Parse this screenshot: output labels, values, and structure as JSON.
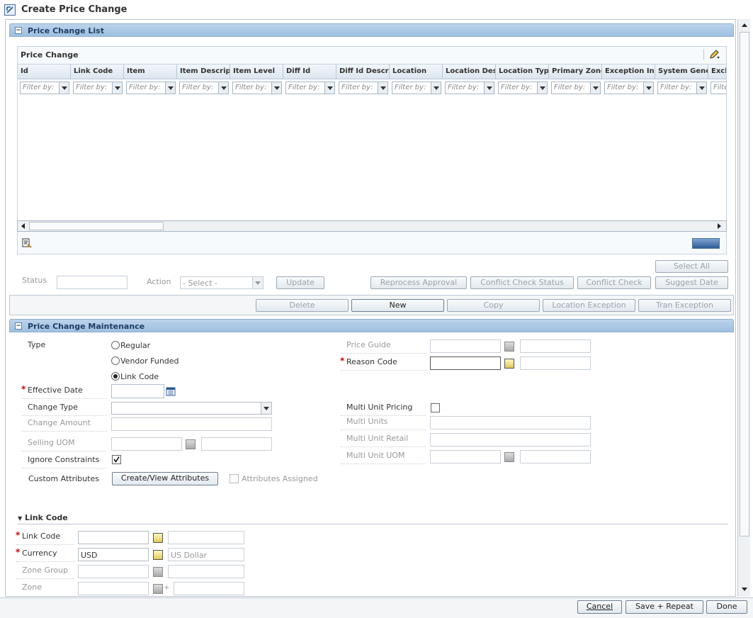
{
  "page": {
    "title": "Create Price Change"
  },
  "price_change_list": {
    "section_title": "Price Change List",
    "grid_title": "Price Change",
    "filter_placeholder": "Filter by:",
    "columns": [
      {
        "label": "Id"
      },
      {
        "label": "Link Code"
      },
      {
        "label": "Item"
      },
      {
        "label": "Item Descripti"
      },
      {
        "label": "Item Level"
      },
      {
        "label": "Diff Id"
      },
      {
        "label": "Diff Id Descrip"
      },
      {
        "label": "Location"
      },
      {
        "label": "Location Desc"
      },
      {
        "label": "Location Type"
      },
      {
        "label": "Primary Zone"
      },
      {
        "label": "Exception Ind"
      },
      {
        "label": "System Gener"
      },
      {
        "label": "Excl"
      }
    ],
    "filter_last": "Filte",
    "status_label": "Status",
    "status_value": "",
    "action_label": "Action",
    "action_value": "- Select -",
    "update_btn": "Update",
    "select_all_btn": "Select All",
    "reprocess_btn": "Reprocess Approval",
    "conflict_status_btn": "Conflict Check Status",
    "conflict_check_btn": "Conflict Check",
    "suggest_date_btn": "Suggest Date",
    "delete_btn": "Delete",
    "new_btn": "New",
    "copy_btn": "Copy",
    "loc_exception_btn": "Location Exception",
    "tran_exception_btn": "Tran Exception"
  },
  "maintenance": {
    "section_title": "Price Change Maintenance",
    "type_label": "Type",
    "type_options": [
      "Regular",
      "Vendor Funded",
      "Link Code"
    ],
    "type_selected": "Link Code",
    "effective_date_label": "Effective Date",
    "effective_date_value": "",
    "change_type_label": "Change Type",
    "change_type_value": "",
    "change_amount_label": "Change Amount",
    "selling_uom_label": "Selling UOM",
    "ignore_constraints_label": "Ignore Constraints",
    "ignore_constraints_checked": true,
    "custom_attributes_label": "Custom Attributes",
    "create_view_btn": "Create/View Attributes",
    "attributes_assigned_label": "Attributes Assigned",
    "price_guide_label": "Price Guide",
    "reason_code_label": "Reason Code",
    "multi_unit_pricing_label": "Multi Unit Pricing",
    "multi_units_label": "Multi Units",
    "multi_unit_retail_label": "Multi Unit Retail",
    "multi_unit_uom_label": "Multi Unit UOM"
  },
  "link_code": {
    "section_title": "Link Code",
    "link_code_label": "Link Code",
    "link_code_value": "",
    "currency_label": "Currency",
    "currency_value": "USD",
    "currency_desc": "US Dollar",
    "zone_group_label": "Zone Group",
    "zone_label": "Zone"
  },
  "footer": {
    "cancel_btn": "Cancel",
    "save_repeat_btn": "Save + Repeat",
    "done_btn": "Done"
  },
  "colors": {
    "section_header": "#9ebfe0",
    "required_marker": "#cc0000"
  }
}
